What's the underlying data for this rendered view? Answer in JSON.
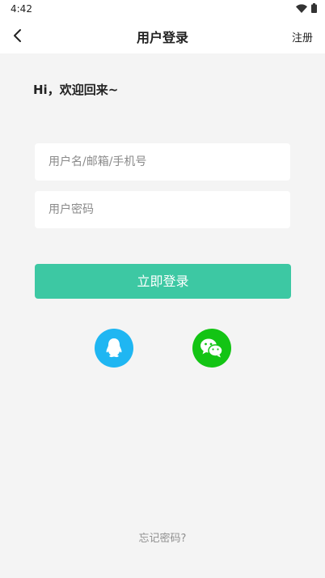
{
  "status_bar": {
    "time": "4:42"
  },
  "app_bar": {
    "title": "用户登录",
    "register_label": "注册"
  },
  "greeting": "Hi，欢迎回来~",
  "form": {
    "username_placeholder": "用户名/邮箱/手机号",
    "password_placeholder": "用户密码",
    "login_label": "立即登录"
  },
  "forgot_password": "忘记密码?",
  "colors": {
    "accent": "#3dc8a3",
    "qq": "#1fb6f2",
    "wechat": "#13c414"
  }
}
